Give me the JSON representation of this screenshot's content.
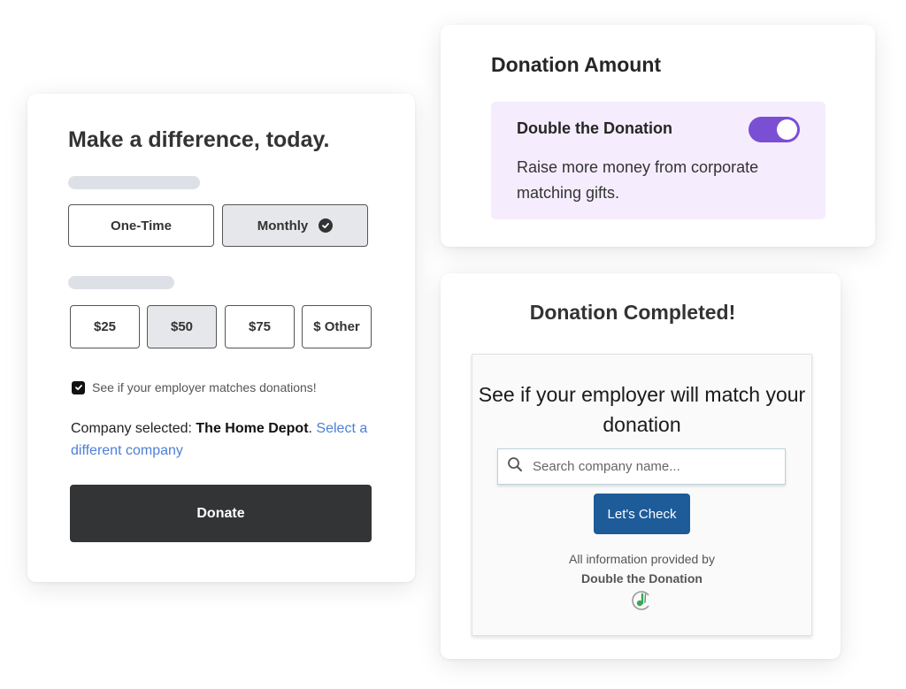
{
  "donation_form": {
    "title": "Make a difference, today.",
    "frequency_options": [
      {
        "label": "One-Time",
        "selected": false
      },
      {
        "label": "Monthly",
        "selected": true
      }
    ],
    "amount_options": [
      {
        "label": "$25",
        "selected": false
      },
      {
        "label": "$50",
        "selected": true
      },
      {
        "label": "$75",
        "selected": false
      },
      {
        "label": "$ Other",
        "selected": false
      }
    ],
    "employer_match_checkbox": {
      "label": "See if your employer matches donations!",
      "checked": true
    },
    "company_prefix": "Company selected: ",
    "company_name": "The Home Depot",
    "company_suffix": ". ",
    "change_company_link": "Select a different company",
    "donate_button": "Donate"
  },
  "donation_amount": {
    "title": "Donation Amount",
    "feature_title": "Double the Donation",
    "feature_description": "Raise more money from corporate matching gifts.",
    "toggle_on": true,
    "accent_color": "#7a4fd4",
    "panel_color": "#f5edfe"
  },
  "donation_completed": {
    "title": "Donation Completed!",
    "widget_title": "See if your employer will match your donation",
    "search_placeholder": "Search company name...",
    "check_button": "Let's Check",
    "provided_by": "All information provided by",
    "provider_name": "Double the Donation",
    "button_color": "#1d5b99"
  }
}
